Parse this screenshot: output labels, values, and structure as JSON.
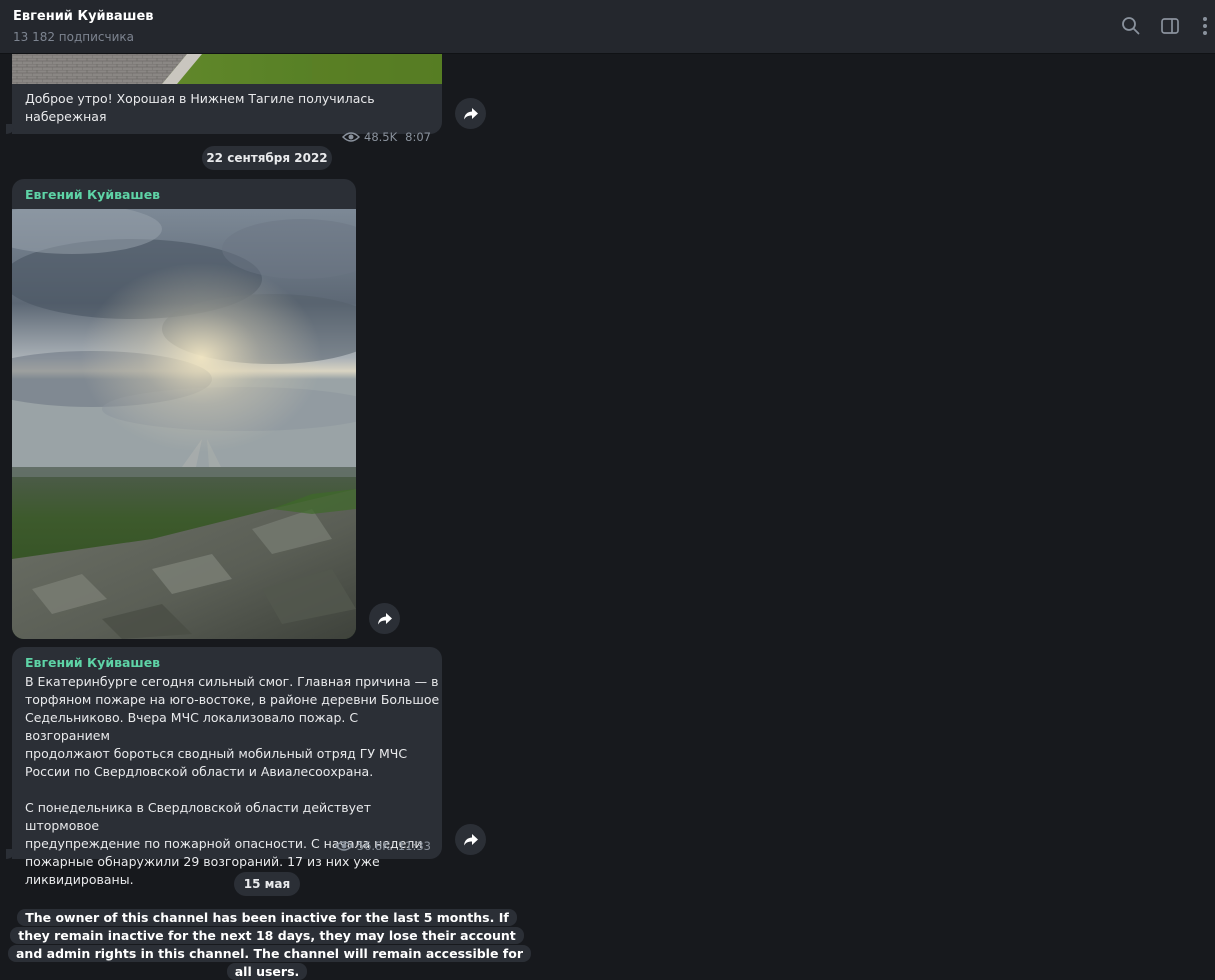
{
  "header": {
    "title": "Евгений Куйвашев",
    "subtitle": "13 182 подписчика"
  },
  "messages": [
    {
      "text": "Доброе утро! Хорошая в Нижнем Тагиле получилась\nнабережная",
      "views": "48.5K",
      "time": "8:07"
    },
    {
      "author": "Евгений Куйвашев"
    },
    {
      "author": "Евгений Куйвашев",
      "text": "В Екатеринбурге сегодня сильный смог. Главная причина — в\nторфяном пожаре на юго-востоке, в районе деревни Большое\nСедельниково. Вчера МЧС локализовало пожар. С возгоранием\nпродолжают бороться сводный мобильный отряд ГУ МЧС\nРоссии по Свердловской области и Авиалесоохрана.\n\nС понедельника в Свердловской области действует штормовое\nпредупреждение по пожарной опасности. С начала недели\nпожарные обнаружили 29 возгораний. 17 из них уже\nликвидированы.",
      "views": "56.8K",
      "time": "11:33"
    }
  ],
  "dates": {
    "first": "22 сентября 2022",
    "second": "15 мая"
  },
  "notice": "The owner of this channel has been inactive for the last 5 months. If they remain inactive for the next 18 days, they may lose their account and admin rights in this channel. The channel will remain accessible for all users.",
  "icons": {
    "search": "search-icon",
    "sidebar": "sidebar-toggle-icon",
    "more": "more-vertical-icon",
    "forward": "forward-icon",
    "views": "eye-icon"
  },
  "colors": {
    "background": "#17191d",
    "header": "#24272d",
    "bubble": "#2b2f36",
    "author": "#5ed3a6",
    "meta": "#8a929d"
  }
}
